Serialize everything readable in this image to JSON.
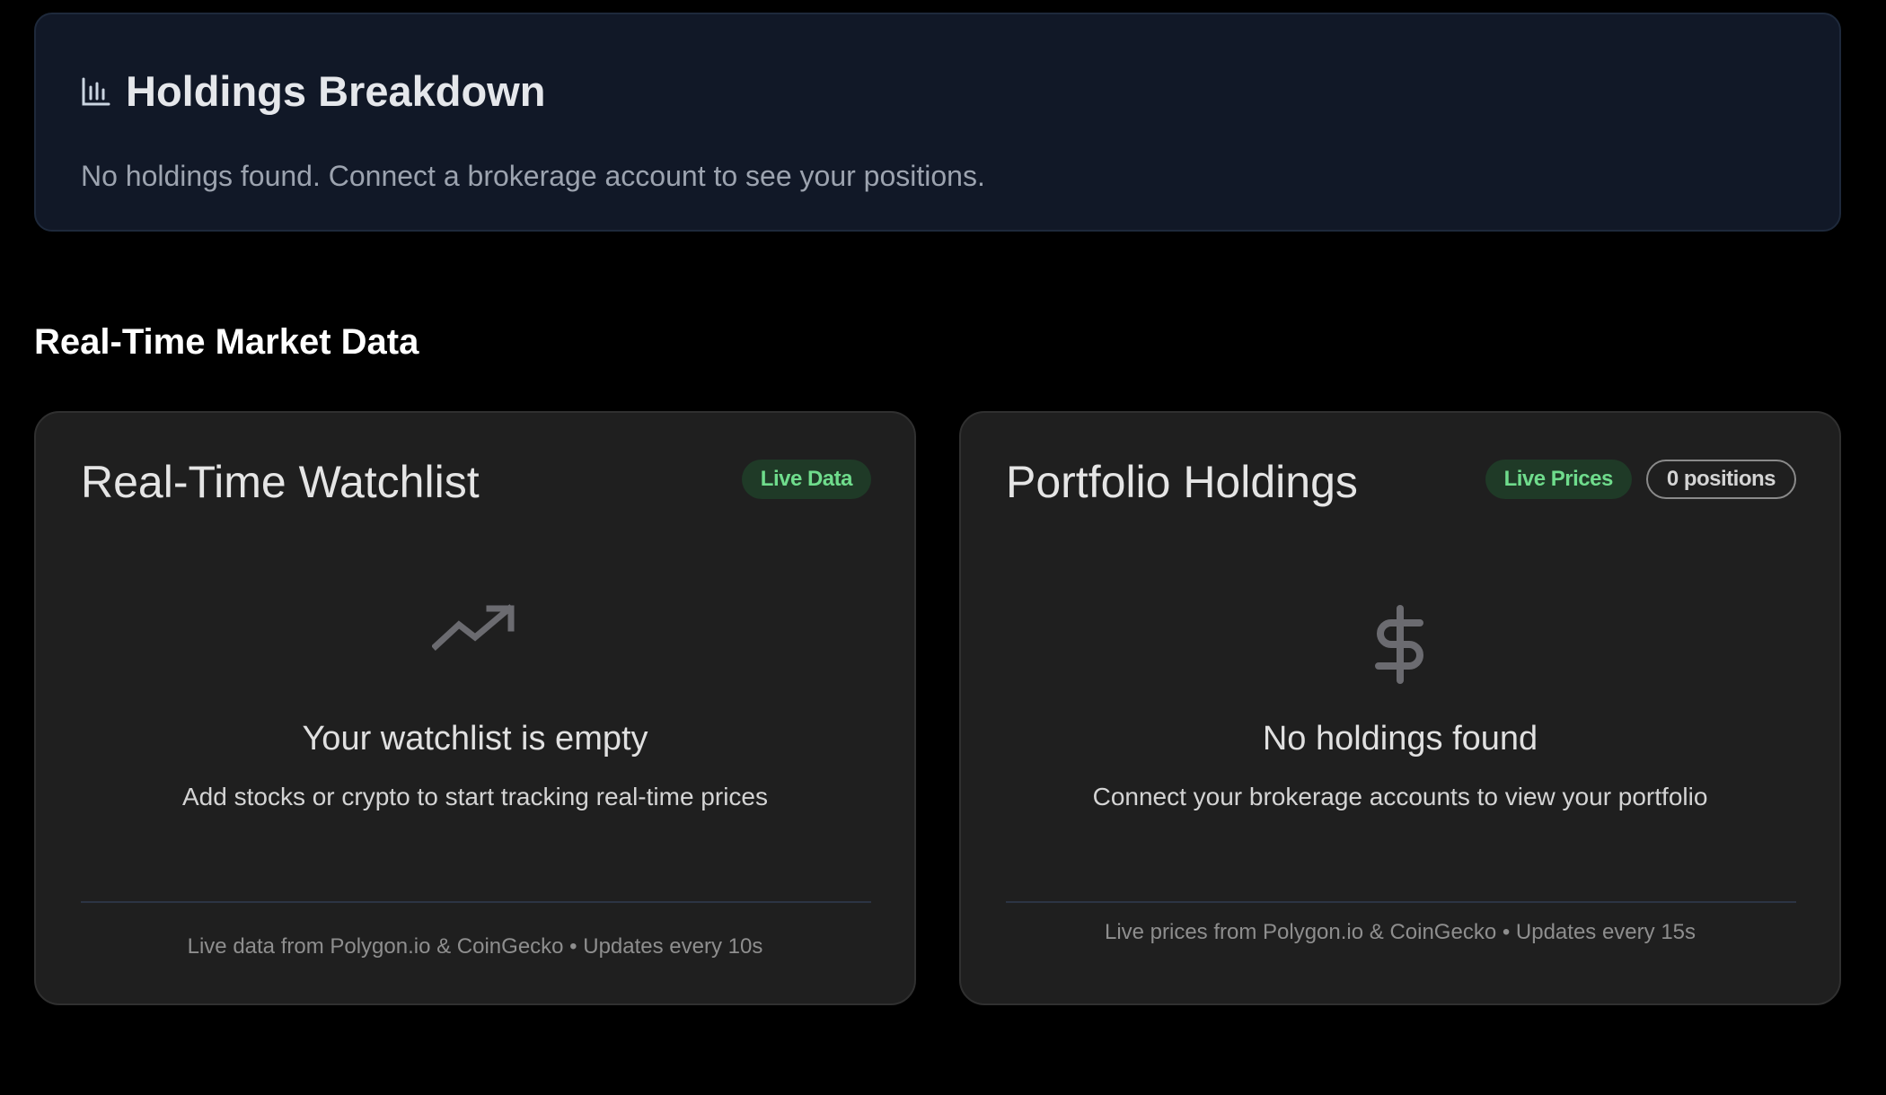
{
  "holdings_breakdown": {
    "icon": "bar-chart-icon",
    "title": "Holdings Breakdown",
    "empty_message": "No holdings found. Connect a brokerage account to see your positions."
  },
  "market_section": {
    "heading": "Real-Time Market Data"
  },
  "watchlist": {
    "title": "Real-Time Watchlist",
    "badge_live": "Live Data",
    "empty_icon": "trending-up-icon",
    "empty_title": "Your watchlist is empty",
    "empty_subtitle": "Add stocks or crypto to start tracking real-time prices",
    "footer": "Live data from Polygon.io & CoinGecko • Updates every 10s"
  },
  "portfolio": {
    "title": "Portfolio Holdings",
    "badge_live": "Live Prices",
    "badge_count": "0 positions",
    "empty_icon": "dollar-sign-icon",
    "empty_title": "No holdings found",
    "empty_subtitle": "Connect your brokerage accounts to view your portfolio",
    "footer": "Live prices from Polygon.io & CoinGecko • Updates every 15s"
  },
  "colors": {
    "page_background": "#000000",
    "breakdown_card": "#111827",
    "panel_background": "#1f1f1f",
    "live_badge_background": "#1f3a27",
    "live_badge_text": "#6fdc8c",
    "muted_icon": "#6b6b70"
  }
}
